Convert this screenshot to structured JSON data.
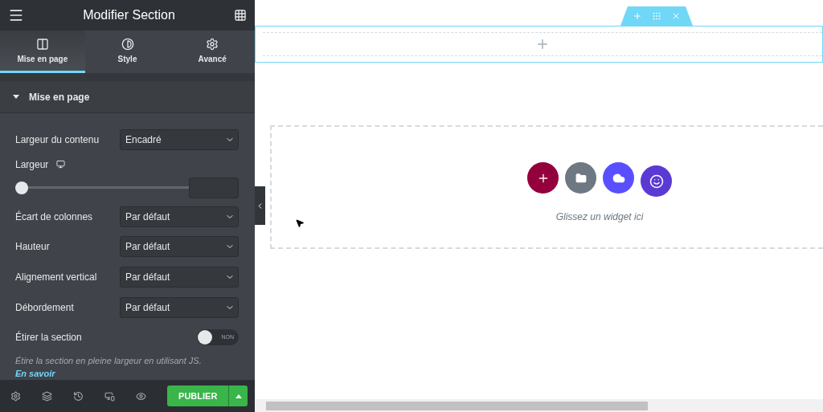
{
  "panel": {
    "title": "Modifier Section",
    "tabs": [
      {
        "label": "Mise en page",
        "selected": true
      },
      {
        "label": "Style",
        "selected": false
      },
      {
        "label": "Avancé",
        "selected": false
      }
    ],
    "section": {
      "title": "Mise en page",
      "expanded": true
    },
    "controls": [
      {
        "kind": "select",
        "label": "Largeur du contenu",
        "value": "Encadré"
      },
      {
        "kind": "slider",
        "label": "Largeur",
        "level": 0
      },
      {
        "kind": "select",
        "label": "Écart de colonnes",
        "value": "Par défaut"
      },
      {
        "kind": "select",
        "label": "Hauteur",
        "value": "Par défaut"
      },
      {
        "kind": "select",
        "label": "Alignement vertical",
        "value": "Par défaut"
      },
      {
        "kind": "select",
        "label": "Débordement",
        "value": "Par défaut"
      },
      {
        "kind": "switch",
        "label": "Étirer la section",
        "on": false,
        "state_label": "NON"
      }
    ],
    "description": {
      "text": "Étire la section en pleine largeur en utilisant JS.",
      "link": "En savoir"
    },
    "footer": {
      "publish": "PUBLIER"
    }
  },
  "canvas": {
    "drop_hint": "Glissez un widget ici"
  }
}
